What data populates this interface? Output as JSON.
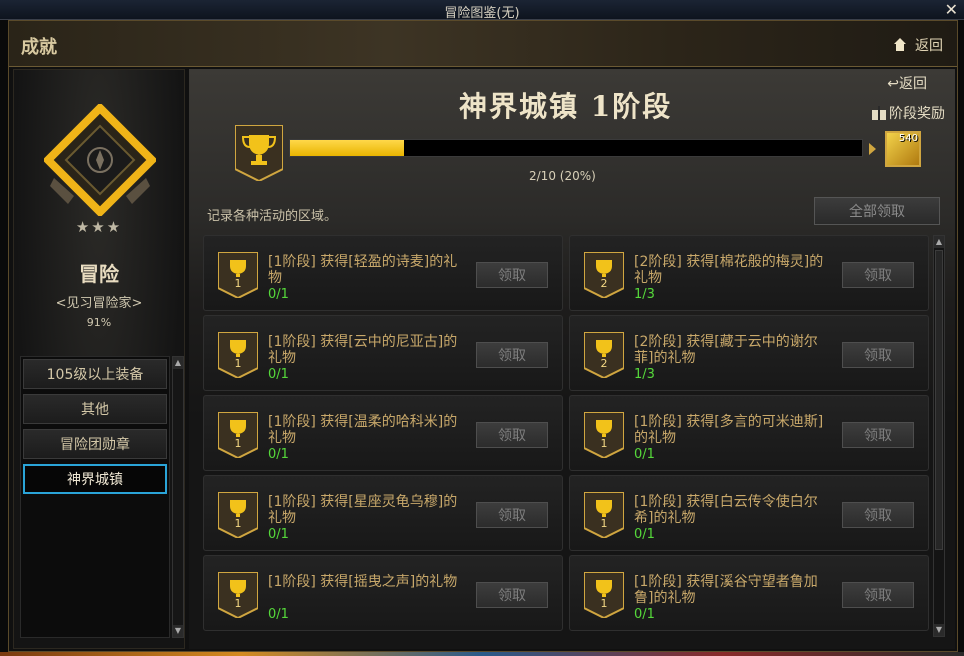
{
  "window": {
    "title": "冒险图鉴(无)",
    "close": "✕"
  },
  "header": {
    "title": "成就",
    "back_label": "返回"
  },
  "colors": {
    "accent_gold": "#e8b400",
    "progress_green": "#55d83a",
    "active_tab_border": "#2aa4d8"
  },
  "profile": {
    "stars": "★★★",
    "rank": "冒险",
    "title": "<见习冒险家>",
    "percent": "91%"
  },
  "categories": [
    {
      "label": "105级以上装备",
      "active": false
    },
    {
      "label": "其他",
      "active": false
    },
    {
      "label": "冒险团勋章",
      "active": false
    },
    {
      "label": "神界城镇",
      "active": true
    }
  ],
  "stage": {
    "back_label": "返回",
    "title": "神界城镇 1阶段",
    "reward_label": "阶段奖励",
    "progress_text": "2/10 (20%)",
    "progress_fraction": 0.2,
    "reward_count": "540",
    "description": "记录各种活动的区域。",
    "claim_all_label": "全部领取"
  },
  "achievements": [
    {
      "level": "1",
      "text": "[1阶段] 获得[轻盈的诗麦]的礼物",
      "progress": "0/1",
      "claim": "领取"
    },
    {
      "level": "2",
      "text": "[2阶段] 获得[棉花般的梅灵]的礼物",
      "progress": "1/3",
      "claim": "领取"
    },
    {
      "level": "1",
      "text": "[1阶段] 获得[云中的尼亚古]的礼物",
      "progress": "0/1",
      "claim": "领取"
    },
    {
      "level": "2",
      "text": "[2阶段] 获得[藏于云中的谢尔菲]的礼物",
      "progress": "1/3",
      "claim": "领取"
    },
    {
      "level": "1",
      "text": "[1阶段] 获得[温柔的哈科米]的礼物",
      "progress": "0/1",
      "claim": "领取"
    },
    {
      "level": "1",
      "text": "[1阶段] 获得[多言的可米迪斯]的礼物",
      "progress": "0/1",
      "claim": "领取"
    },
    {
      "level": "1",
      "text": "[1阶段] 获得[星座灵龟乌穆]的礼物",
      "progress": "0/1",
      "claim": "领取"
    },
    {
      "level": "1",
      "text": "[1阶段] 获得[白云传令使白尔希]的礼物",
      "progress": "0/1",
      "claim": "领取"
    },
    {
      "level": "1",
      "text": "[1阶段] 获得[摇曳之声]的礼物",
      "progress": "0/1",
      "claim": "领取"
    },
    {
      "level": "1",
      "text": "[1阶段] 获得[溪谷守望者鲁加鲁]的礼物",
      "progress": "0/1",
      "claim": "领取"
    }
  ]
}
